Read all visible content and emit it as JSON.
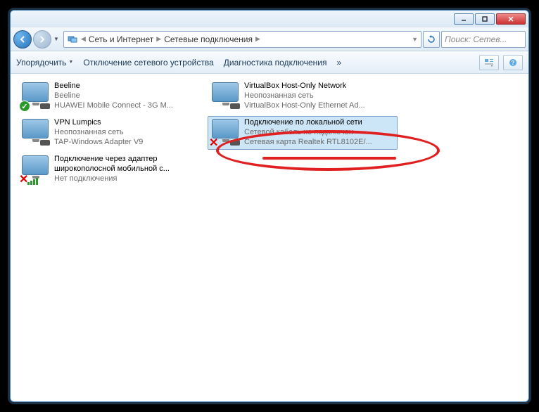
{
  "titlebar": {},
  "nav": {
    "breadcrumbs": [
      "Сеть и Интернет",
      "Сетевые подключения"
    ],
    "search_placeholder": "Поиск: Сетев..."
  },
  "toolbar": {
    "organize": "Упорядочить",
    "disable": "Отключение сетевого устройства",
    "diagnose": "Диагностика подключения",
    "more": "»"
  },
  "items": [
    {
      "name": "Beeline",
      "line2": "Beeline",
      "line3": "HUAWEI Mobile Connect - 3G M...",
      "overlay": "check"
    },
    {
      "name": "VirtualBox Host-Only Network",
      "line2": "Неопознанная сеть",
      "line3": "VirtualBox Host-Only Ethernet Ad...",
      "overlay": "none"
    },
    {
      "name": "VPN Lumpics",
      "line2": "Неопознанная сеть",
      "line3": "TAP-Windows Adapter V9",
      "overlay": "none"
    },
    {
      "name": "Подключение по локальной сети",
      "line2": "Сетевой кабель не подключен",
      "line3": "Сетевая карта Realtek RTL8102E/...",
      "overlay": "x",
      "selected": true
    },
    {
      "name": "Подключение через адаптер широкополосной мобильной с...",
      "line2": "",
      "line3": "Нет подключения",
      "overlay": "bars-x"
    }
  ]
}
